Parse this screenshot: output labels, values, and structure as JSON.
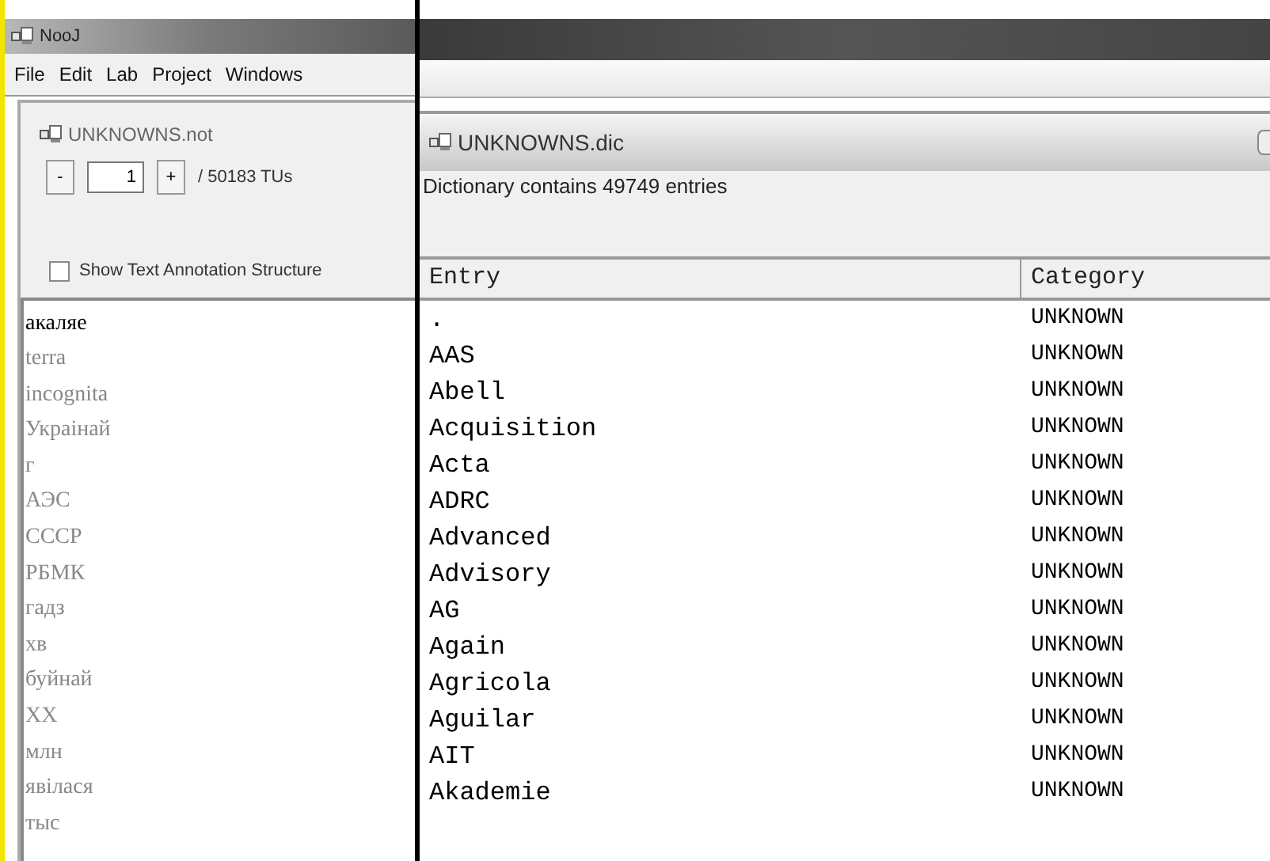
{
  "main_window": {
    "title": "NooJ",
    "menu": [
      "File",
      "Edit",
      "Lab",
      "Project",
      "Windows"
    ]
  },
  "text_window": {
    "title": "UNKNOWNS.not",
    "minus": "-",
    "current": "1",
    "plus": "+",
    "total": "/ 50183 TUs",
    "show_annotation": {
      "label": "Show Text Annotation Structure",
      "checked": false
    },
    "units": [
      {
        "text": "акаляе",
        "selected": true
      },
      {
        "text": "terra",
        "selected": false
      },
      {
        "text": "incognita",
        "selected": false
      },
      {
        "text": "Украінай",
        "selected": false
      },
      {
        "text": "г",
        "selected": false
      },
      {
        "text": "АЭС",
        "selected": false
      },
      {
        "text": "СССР",
        "selected": false
      },
      {
        "text": "РБМК",
        "selected": false
      },
      {
        "text": "гадз",
        "selected": false
      },
      {
        "text": "хв",
        "selected": false
      },
      {
        "text": "буйнай",
        "selected": false
      },
      {
        "text": "ХХ",
        "selected": false
      },
      {
        "text": "млн",
        "selected": false
      },
      {
        "text": "явілася",
        "selected": false
      },
      {
        "text": "тыс",
        "selected": false
      }
    ]
  },
  "dictionary_window": {
    "title": "UNKNOWNS.dic",
    "summary": "Dictionary contains 49749 entries",
    "columns": [
      "Entry",
      "Category"
    ],
    "rows": [
      [
        ".",
        "UNKNOWN"
      ],
      [
        "AAS",
        "UNKNOWN"
      ],
      [
        "Abell",
        "UNKNOWN"
      ],
      [
        "Acquisition",
        "UNKNOWN"
      ],
      [
        "Acta",
        "UNKNOWN"
      ],
      [
        "ADRC",
        "UNKNOWN"
      ],
      [
        "Advanced",
        "UNKNOWN"
      ],
      [
        "Advisory",
        "UNKNOWN"
      ],
      [
        "AG",
        "UNKNOWN"
      ],
      [
        "Again",
        "UNKNOWN"
      ],
      [
        "Agricola",
        "UNKNOWN"
      ],
      [
        "Aguilar",
        "UNKNOWN"
      ],
      [
        "AIT",
        "UNKNOWN"
      ],
      [
        "Akademie",
        "UNKNOWN"
      ]
    ]
  }
}
